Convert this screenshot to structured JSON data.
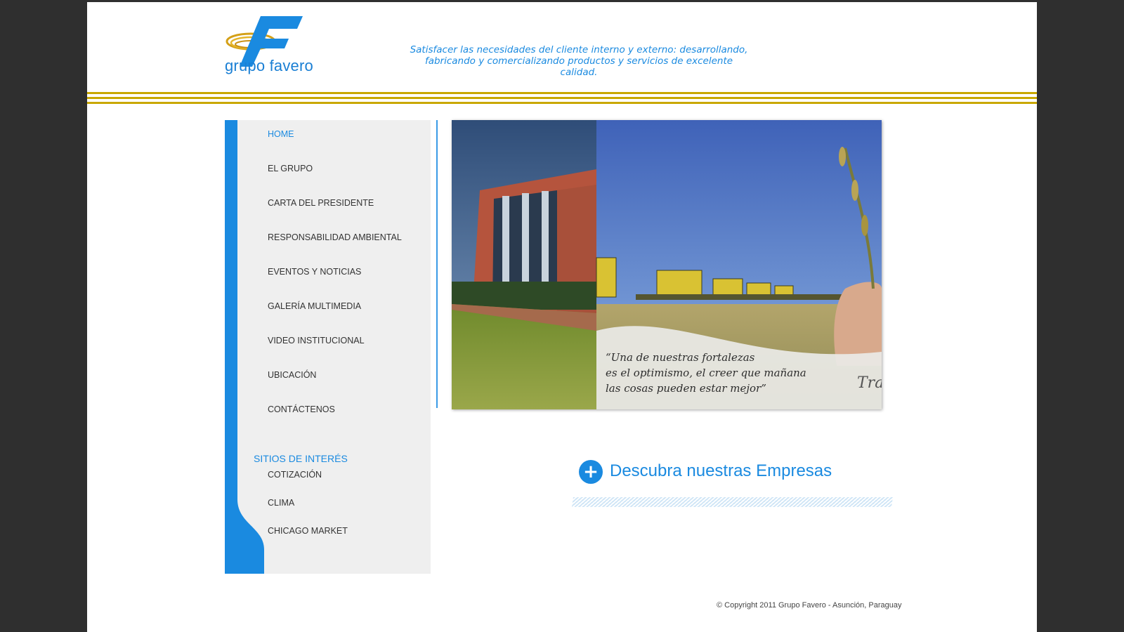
{
  "brand": {
    "name": "grupo favero"
  },
  "header": {
    "mission_line1": "Satisfacer las necesidades del cliente interno y externo: desarrollando,",
    "mission_line2": "fabricando y comercializando productos y servicios de excelente",
    "mission_line3": "calidad."
  },
  "colors": {
    "accent": "#1a8ae0",
    "gold": "#c9a800",
    "sidebar_bg": "#efefef"
  },
  "nav": {
    "items": [
      {
        "label": "HOME",
        "active": true
      },
      {
        "label": "EL GRUPO"
      },
      {
        "label": "CARTA DEL PRESIDENTE"
      },
      {
        "label": "RESPONSABILIDAD AMBIENTAL"
      },
      {
        "label": "EVENTOS Y NOTICIAS"
      },
      {
        "label": "GALERÍA MULTIMEDIA"
      },
      {
        "label": "VIDEO INSTITUCIONAL"
      },
      {
        "label": "UBICACIÓN"
      },
      {
        "label": "CONTÁCTENOS"
      }
    ],
    "sites_title": "SITIOS DE INTERÉS",
    "sites": [
      {
        "label": "COTIZACIÓN"
      },
      {
        "label": "CLIMA"
      },
      {
        "label": "CHICAGO MARKET"
      }
    ]
  },
  "banner": {
    "quote_line1": "“Una de nuestras fortalezas",
    "quote_line2": "es el optimismo, el creer que mañana",
    "quote_line3": "las cosas pueden estar mejor”",
    "signature": "Tra"
  },
  "discover": {
    "label": "Descubra nuestras Empresas"
  },
  "footer": {
    "copyright": "© Copyright 2011 Grupo Favero - Asunción, Paraguay"
  }
}
